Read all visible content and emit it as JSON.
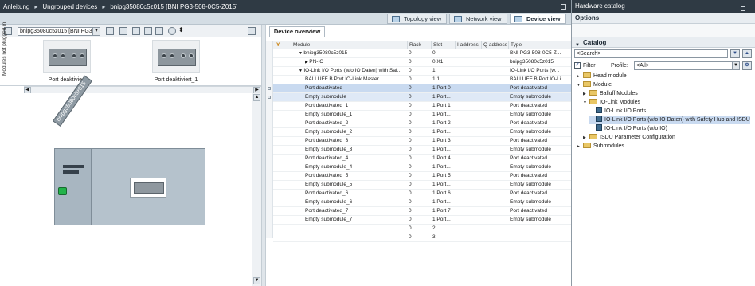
{
  "titlebar": {
    "crumbs": [
      "Anleitung",
      "Ungrouped devices",
      "bnipg35080c5z015 [BNI PG3-508-0C5-Z015]"
    ]
  },
  "view_tabs": {
    "topology": "Topology view",
    "network": "Network view",
    "device": "Device view"
  },
  "device_toolbar": {
    "selected_device": "bnipg35080c5z015 [BNI PG3-"
  },
  "not_plugged": {
    "label": "Modules not plugged in",
    "items": [
      "Port deaktiviert",
      "Port deaktiviert_1"
    ]
  },
  "canvas": {
    "rack_label": "bnipg35080c5z015"
  },
  "overview": {
    "tab_label": "Device overview",
    "columns": [
      "Module",
      "Rack",
      "Slot",
      "I address",
      "Q address",
      "Type"
    ],
    "rows": [
      {
        "module": "bnipg35080c5z015",
        "rack": "0",
        "slot": "0",
        "type": "BNI PG3-508-0C5-Z...",
        "indent": 1,
        "expander": "▼",
        "state": ""
      },
      {
        "module": "PN-IO",
        "rack": "0",
        "slot": "0 X1",
        "type": "bnipg35080c5z015",
        "indent": 2,
        "expander": "▶",
        "state": ""
      },
      {
        "module": "IO-Link I/O Ports (w/o IO Daten) with Saf...",
        "rack": "0",
        "slot": "1",
        "type": "IO-Link I/O Ports (w...",
        "indent": 1,
        "expander": "▼",
        "state": ""
      },
      {
        "module": "BALLUFF B Port IO-Link Master",
        "rack": "0",
        "slot": "1 1",
        "type": "BALLUFF B Port IO-Li...",
        "indent": 2,
        "expander": "",
        "state": ""
      },
      {
        "module": "Port deactivated",
        "rack": "0",
        "slot": "1 Port 0",
        "type": "Port deactivated",
        "indent": 2,
        "expander": "",
        "state": "sel1"
      },
      {
        "module": "Empty submodule",
        "rack": "0",
        "slot": "1 Port...",
        "type": "Empty submodule",
        "indent": 2,
        "expander": "",
        "state": "sel2"
      },
      {
        "module": "Port deactivated_1",
        "rack": "0",
        "slot": "1 Port 1",
        "type": "Port deactivated",
        "indent": 2,
        "expander": "",
        "state": ""
      },
      {
        "module": "Empty submodule_1",
        "rack": "0",
        "slot": "1 Port...",
        "type": "Empty submodule",
        "indent": 2,
        "expander": "",
        "state": ""
      },
      {
        "module": "Port deactivated_2",
        "rack": "0",
        "slot": "1 Port 2",
        "type": "Port deactivated",
        "indent": 2,
        "expander": "",
        "state": ""
      },
      {
        "module": "Empty submodule_2",
        "rack": "0",
        "slot": "1 Port...",
        "type": "Empty submodule",
        "indent": 2,
        "expander": "",
        "state": ""
      },
      {
        "module": "Port deactivated_3",
        "rack": "0",
        "slot": "1 Port 3",
        "type": "Port deactivated",
        "indent": 2,
        "expander": "",
        "state": ""
      },
      {
        "module": "Empty submodule_3",
        "rack": "0",
        "slot": "1 Port...",
        "type": "Empty submodule",
        "indent": 2,
        "expander": "",
        "state": ""
      },
      {
        "module": "Port deactivated_4",
        "rack": "0",
        "slot": "1 Port 4",
        "type": "Port deactivated",
        "indent": 2,
        "expander": "",
        "state": ""
      },
      {
        "module": "Empty submodule_4",
        "rack": "0",
        "slot": "1 Port...",
        "type": "Empty submodule",
        "indent": 2,
        "expander": "",
        "state": ""
      },
      {
        "module": "Port deactivated_5",
        "rack": "0",
        "slot": "1 Port 5",
        "type": "Port deactivated",
        "indent": 2,
        "expander": "",
        "state": ""
      },
      {
        "module": "Empty submodule_5",
        "rack": "0",
        "slot": "1 Port...",
        "type": "Empty submodule",
        "indent": 2,
        "expander": "",
        "state": ""
      },
      {
        "module": "Port deactivated_6",
        "rack": "0",
        "slot": "1 Port 6",
        "type": "Port deactivated",
        "indent": 2,
        "expander": "",
        "state": ""
      },
      {
        "module": "Empty submodule_6",
        "rack": "0",
        "slot": "1 Port...",
        "type": "Empty submodule",
        "indent": 2,
        "expander": "",
        "state": ""
      },
      {
        "module": "Port deactivated_7",
        "rack": "0",
        "slot": "1 Port 7",
        "type": "Port deactivated",
        "indent": 2,
        "expander": "",
        "state": ""
      },
      {
        "module": "Empty submodule_7",
        "rack": "0",
        "slot": "1 Port...",
        "type": "Empty submodule",
        "indent": 2,
        "expander": "",
        "state": ""
      },
      {
        "module": "",
        "rack": "0",
        "slot": "2",
        "type": "",
        "indent": 2,
        "expander": "",
        "state": ""
      },
      {
        "module": "",
        "rack": "0",
        "slot": "3",
        "type": "",
        "indent": 2,
        "expander": "",
        "state": ""
      }
    ]
  },
  "catalog": {
    "title": "Hardware catalog",
    "options_label": "Options",
    "catalog_label": "Catalog",
    "search_placeholder": "<Search>",
    "filter_label": "Filter",
    "profile_label": "Profile:",
    "profile_value": "<All>",
    "tree": [
      {
        "label": "Head module",
        "level": 0,
        "expander": "▶",
        "kind": "folder",
        "selected": false
      },
      {
        "label": "Module",
        "level": 0,
        "expander": "▼",
        "kind": "folder",
        "selected": false
      },
      {
        "label": "Balluff Modules",
        "level": 1,
        "expander": "▶",
        "kind": "folder",
        "selected": false
      },
      {
        "label": "IO-Link Modules",
        "level": 1,
        "expander": "▼",
        "kind": "folder",
        "selected": false
      },
      {
        "label": "IO-Link I/O Ports",
        "level": 2,
        "expander": "",
        "kind": "leaf",
        "selected": false
      },
      {
        "label": "IO-Link I/O Ports (w/o IO Daten) with Safety Hub and ISDU",
        "level": 2,
        "expander": "",
        "kind": "leaf",
        "selected": true
      },
      {
        "label": "IO-Link I/O Ports (w/o IO)",
        "level": 2,
        "expander": "",
        "kind": "leaf",
        "selected": false
      },
      {
        "label": "ISDU Parameter Configuration",
        "level": 1,
        "expander": "▶",
        "kind": "folder",
        "selected": false
      },
      {
        "label": "Submodules",
        "level": 0,
        "expander": "▶",
        "kind": "folder",
        "selected": false
      }
    ]
  }
}
